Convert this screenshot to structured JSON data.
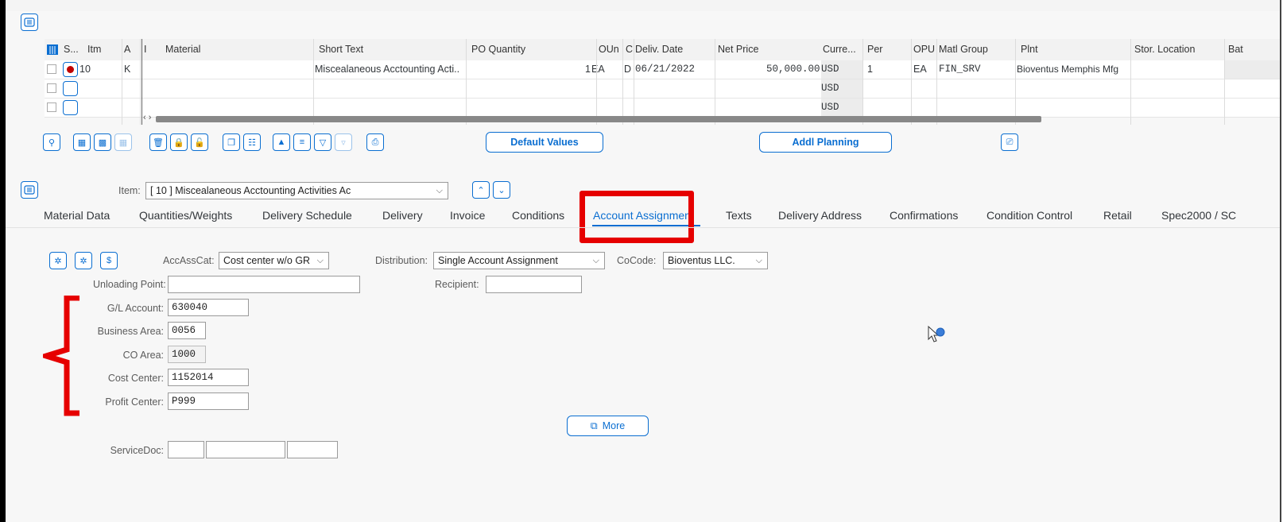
{
  "table": {
    "headers": [
      "S...",
      "Itm",
      "A",
      "I",
      "Material",
      "Short Text",
      "PO Quantity",
      "OUn",
      "C",
      "Deliv. Date",
      "Net Price",
      "Curre...",
      "Per",
      "OPU",
      "Matl Group",
      "Plnt",
      "Stor. Location",
      "Bat"
    ],
    "rows": [
      {
        "itm": "10",
        "a": "K",
        "material": "",
        "short_text": "Miscealaneous Acctounting Acti..",
        "po_qty": "1",
        "oun": "EA",
        "c": "D",
        "deliv_date": "06/21/2022",
        "net_price": "50,000.00",
        "currency": "USD",
        "per": "1",
        "opu": "EA",
        "matl_group": "FIN_SRV",
        "plnt": "Bioventus Memphis Mfg"
      },
      {
        "currency": "USD"
      },
      {
        "currency": "USD"
      }
    ],
    "scroll_arrows": "‹ ›"
  },
  "toolbar": {
    "default_values": "Default Values",
    "addl_planning": "Addl Planning"
  },
  "item": {
    "label": "Item:",
    "value": "[ 10 ] Miscealaneous Acctounting Activities Ac"
  },
  "tabs": [
    "Material Data",
    "Quantities/Weights",
    "Delivery Schedule",
    "Delivery",
    "Invoice",
    "Conditions",
    "Account Assignment",
    "Texts",
    "Delivery Address",
    "Confirmations",
    "Condition Control",
    "Retail",
    "Spec2000 / SC"
  ],
  "active_tab": "Account Assignment",
  "form": {
    "accasscat_label": "AccAssCat:",
    "accasscat_value": "Cost center w/o GR",
    "distribution_label": "Distribution:",
    "distribution_value": "Single Account Assignment",
    "cocode_label": "CoCode:",
    "cocode_value": "Bioventus LLC.",
    "unloading_label": "Unloading Point:",
    "unloading_value": "",
    "recipient_label": "Recipient:",
    "recipient_value": "",
    "gl_label": "G/L Account:",
    "gl_value": "630040",
    "ba_label": "Business Area:",
    "ba_value": "0056",
    "co_label": "CO Area:",
    "co_value": "1000",
    "cc_label": "Cost Center:",
    "cc_value": "1152014",
    "pc_label": "Profit Center:",
    "pc_value": "P999",
    "more_label": "More",
    "servicedoc_label": "ServiceDoc:"
  },
  "colors": {
    "accent": "#0a6ed1",
    "highlight": "#e60000"
  }
}
